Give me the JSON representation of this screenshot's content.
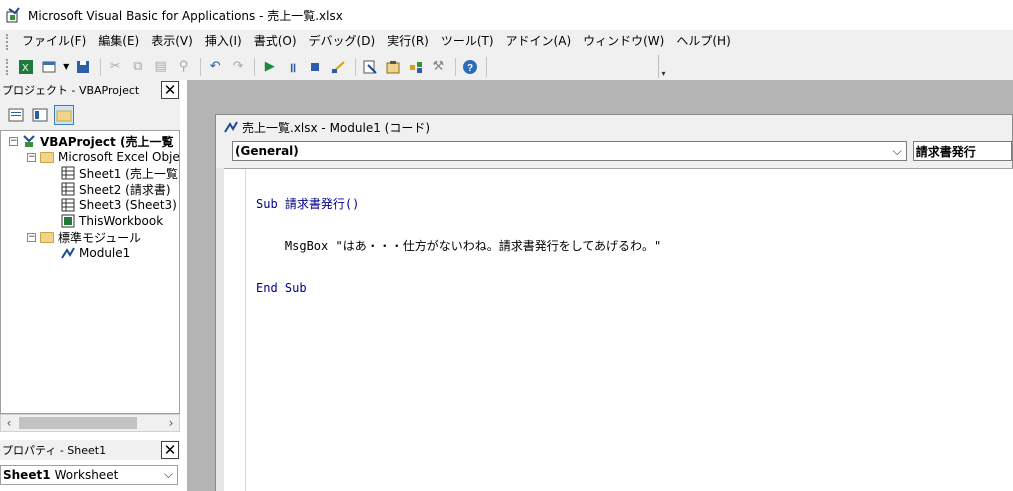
{
  "window": {
    "title": "Microsoft Visual Basic for Applications - 売上一覧.xlsx",
    "app_icon": "vba-app-icon"
  },
  "menu": [
    "ファイル(F)",
    "編集(E)",
    "表示(V)",
    "挿入(I)",
    "書式(O)",
    "デバッグ(D)",
    "実行(R)",
    "ツール(T)",
    "アドイン(A)",
    "ウィンドウ(W)",
    "ヘルプ(H)"
  ],
  "toolbar": {
    "buttons": [
      "excel-icon",
      "insert-module-icon",
      "save-icon",
      "cut-icon",
      "copy-icon",
      "paste-icon",
      "find-icon",
      "undo-icon",
      "redo-icon",
      "run-icon",
      "break-icon",
      "reset-icon",
      "design-mode-icon",
      "project-explorer-icon",
      "properties-icon",
      "object-browser-icon",
      "toolbox-icon",
      "help-icon"
    ]
  },
  "project_panel": {
    "title": "プロジェクト - VBAProject",
    "tree": [
      {
        "label": "VBAProject (売上一覧",
        "level": 0,
        "expander": "−",
        "icon": "vba-project-icon",
        "bold": true
      },
      {
        "label": "Microsoft Excel Object",
        "level": 1,
        "expander": "−",
        "icon": "folder-icon"
      },
      {
        "label": "Sheet1 (売上一覧)",
        "level": 2,
        "icon": "sheet-icon"
      },
      {
        "label": "Sheet2 (請求書)",
        "level": 2,
        "icon": "sheet-icon"
      },
      {
        "label": "Sheet3 (Sheet3)",
        "level": 2,
        "icon": "sheet-icon"
      },
      {
        "label": "ThisWorkbook",
        "level": 2,
        "icon": "workbook-icon"
      },
      {
        "label": "標準モジュール",
        "level": 1,
        "expander": "−",
        "icon": "folder-icon"
      },
      {
        "label": "Module1",
        "level": 2,
        "icon": "module-icon"
      }
    ]
  },
  "properties_panel": {
    "title": "プロパティ - Sheet1",
    "object_name": "Sheet1",
    "object_type": "Worksheet"
  },
  "code_window": {
    "title": "売上一覧.xlsx - Module1 (コード)",
    "object_combo": "(General)",
    "proc_combo": "請求書発行",
    "lines": [
      "Sub 請求書発行()",
      "    MsgBox \"はあ・・・仕方がないわね。請求書発行をしてあげるわ。\"",
      "End Sub"
    ]
  }
}
